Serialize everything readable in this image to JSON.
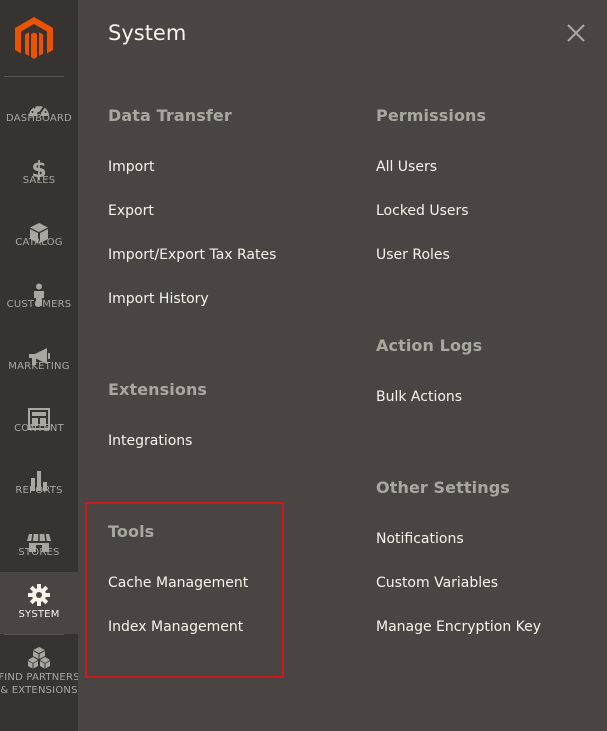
{
  "sidebar": {
    "items": [
      {
        "label": "DASHBOARD",
        "icon": "dashboard-icon"
      },
      {
        "label": "SALES",
        "icon": "dollar-icon"
      },
      {
        "label": "CATALOG",
        "icon": "cube-icon"
      },
      {
        "label": "CUSTOMERS",
        "icon": "person-icon"
      },
      {
        "label": "MARKETING",
        "icon": "megaphone-icon"
      },
      {
        "label": "CONTENT",
        "icon": "layout-icon"
      },
      {
        "label": "REPORTS",
        "icon": "bar-chart-icon"
      },
      {
        "label": "STORES",
        "icon": "storefront-icon"
      },
      {
        "label": "SYSTEM",
        "icon": "gear-icon"
      },
      {
        "label": "FIND PARTNERS & EXTENSIONS",
        "icon": "boxes-icon"
      }
    ],
    "active": "SYSTEM"
  },
  "panel": {
    "title": "System",
    "left_column": [
      {
        "title": "Data Transfer",
        "links": [
          "Import",
          "Export",
          "Import/Export Tax Rates",
          "Import History"
        ]
      },
      {
        "title": "Extensions",
        "links": [
          "Integrations"
        ]
      },
      {
        "title": "Tools",
        "links": [
          "Cache Management",
          "Index Management"
        ]
      }
    ],
    "right_column": [
      {
        "title": "Permissions",
        "links": [
          "All Users",
          "Locked Users",
          "User Roles"
        ]
      },
      {
        "title": "Action Logs",
        "links": [
          "Bulk Actions"
        ]
      },
      {
        "title": "Other Settings",
        "links": [
          "Notifications",
          "Custom Variables",
          "Manage Encryption Key"
        ]
      }
    ]
  },
  "colors": {
    "sidebar_bg": "#373330",
    "panel_bg": "#4a4542",
    "brand_orange": "#eb5202",
    "highlight_red": "#c8191e",
    "text_light": "#f7f3eb",
    "text_muted": "#aaa6a0"
  }
}
